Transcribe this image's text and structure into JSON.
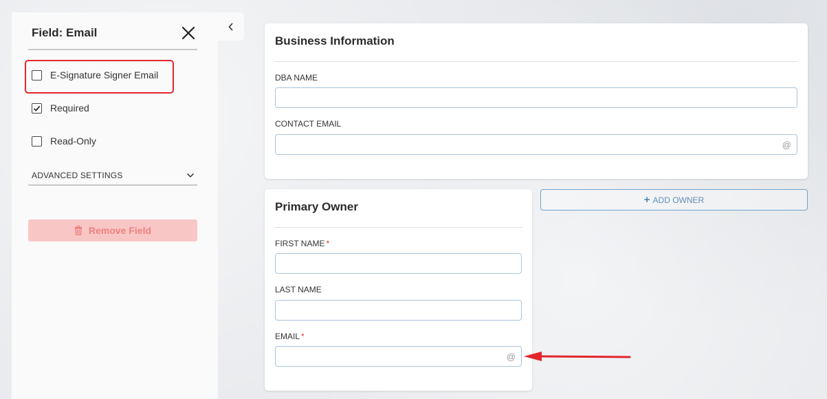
{
  "sidebar": {
    "title": "Field: Email",
    "options": [
      {
        "label": "E-Signature Signer Email",
        "checked": false
      },
      {
        "label": "Required",
        "checked": true
      },
      {
        "label": "Read-Only",
        "checked": false
      }
    ],
    "advanced_label": "ADVANCED SETTINGS",
    "remove_label": "Remove Field"
  },
  "business": {
    "title": "Business Information",
    "dba_label": "DBA NAME",
    "contact_label": "CONTACT EMAIL",
    "at_symbol": "@"
  },
  "owner": {
    "title": "Primary Owner",
    "first_label": "FIRST NAME",
    "last_label": "LAST NAME",
    "email_label": "EMAIL",
    "required_mark": "*",
    "at_symbol": "@"
  },
  "add_owner_label": "ADD OWNER",
  "add_owner_plus": "+",
  "colors": {
    "annotation": "#e3262c",
    "input_border": "#a9c4dc",
    "remove_bg": "#f9c6c6"
  }
}
